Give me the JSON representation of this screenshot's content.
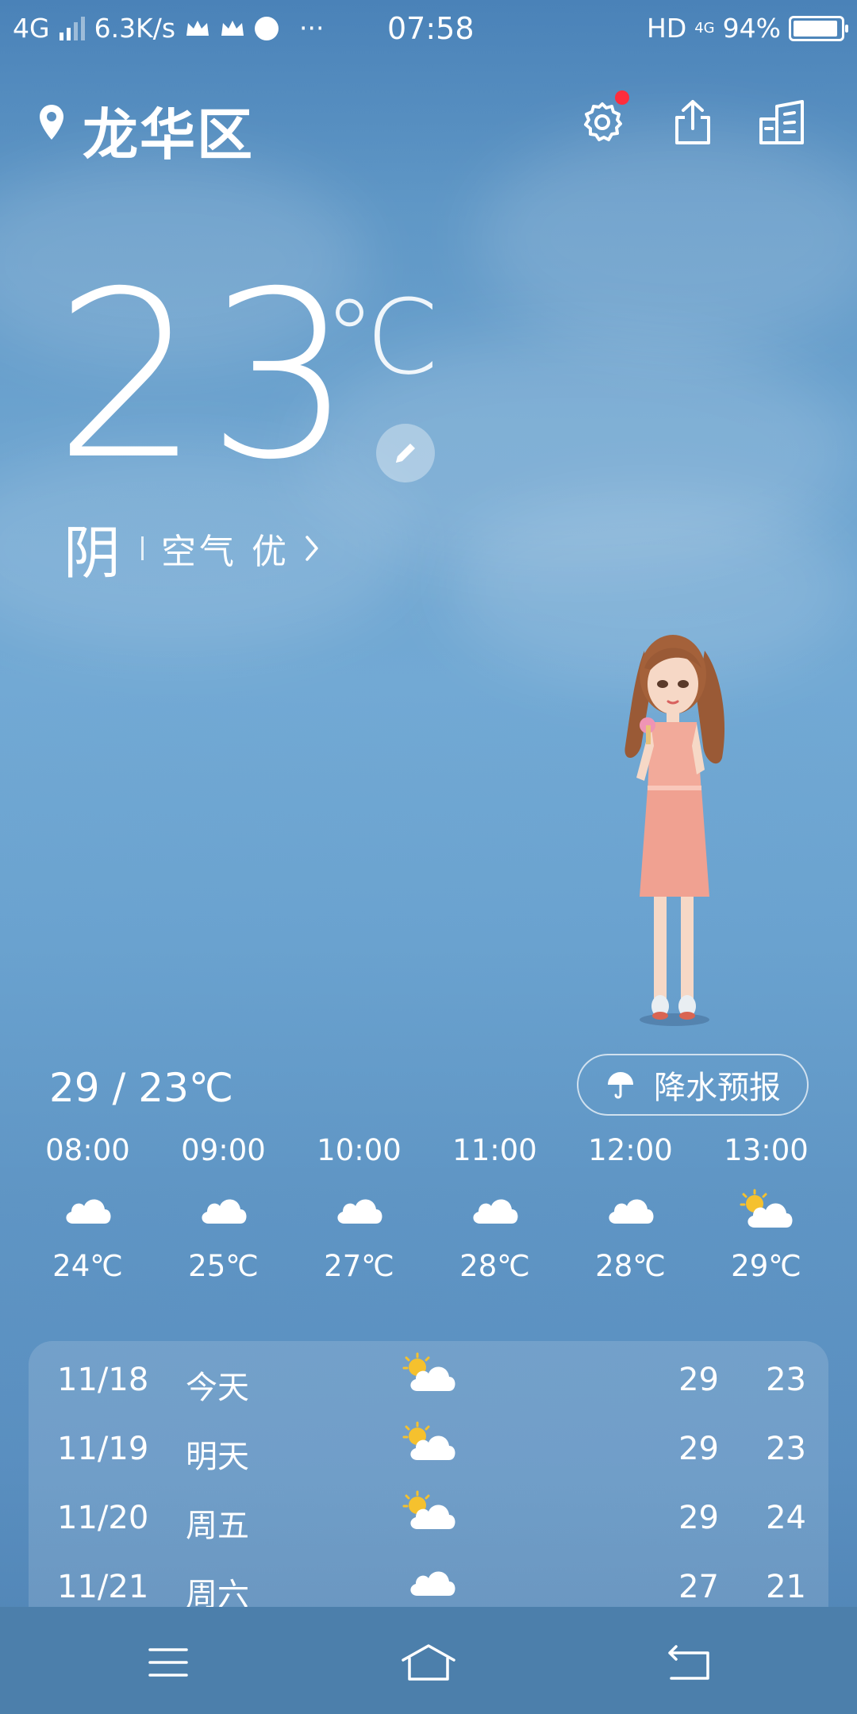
{
  "status_bar": {
    "network": "4G",
    "speed": "6.3K/s",
    "more": "···",
    "time": "07:58",
    "hd": "HD",
    "net_small": "4G",
    "battery_text": "94%",
    "battery_level": 0.94
  },
  "header": {
    "location": "龙华区",
    "icons": [
      "location-pin-icon",
      "settings-icon",
      "share-icon",
      "city-management-icon"
    ],
    "settings_has_notification": true
  },
  "current": {
    "temperature": "23",
    "unit": "℃",
    "condition": "阴",
    "air_quality": "空气 优"
  },
  "today": {
    "range": "29 / 23℃",
    "precip_button": "降水预报"
  },
  "hourly": [
    {
      "time": "08:00",
      "icon": "cloudy",
      "temp": "24℃"
    },
    {
      "time": "09:00",
      "icon": "cloudy",
      "temp": "25℃"
    },
    {
      "time": "10:00",
      "icon": "cloudy",
      "temp": "27℃"
    },
    {
      "time": "11:00",
      "icon": "cloudy",
      "temp": "28℃"
    },
    {
      "time": "12:00",
      "icon": "cloudy",
      "temp": "28℃"
    },
    {
      "time": "13:00",
      "icon": "partly-cloudy",
      "temp": "29℃"
    }
  ],
  "daily": [
    {
      "date": "11/18",
      "day": "今天",
      "icon": "partly-cloudy",
      "high": "29",
      "low": "23"
    },
    {
      "date": "11/19",
      "day": "明天",
      "icon": "partly-cloudy",
      "high": "29",
      "low": "23"
    },
    {
      "date": "11/20",
      "day": "周五",
      "icon": "partly-cloudy",
      "high": "29",
      "low": "24"
    },
    {
      "date": "11/21",
      "day": "周六",
      "icon": "cloudy",
      "high": "27",
      "low": "21"
    }
  ],
  "colors": {
    "sky_top": "#4a82b8",
    "sky_mid": "#72a9d4",
    "navbar": "#4c7fab",
    "notification": "#ff2d3d",
    "sun": "#f5c12e"
  }
}
